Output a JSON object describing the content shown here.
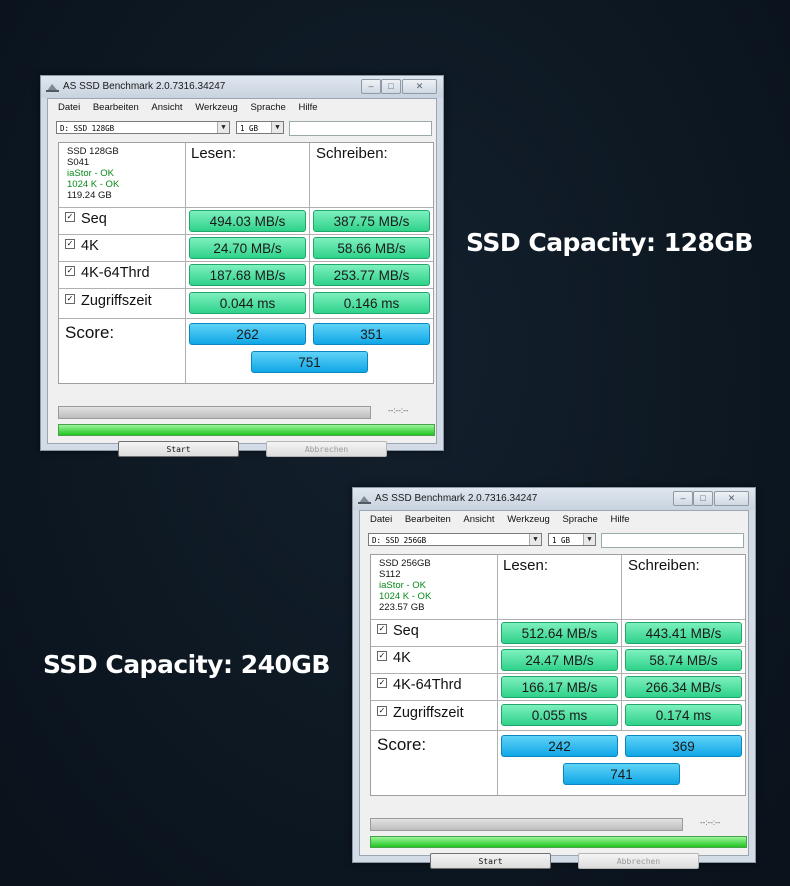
{
  "captions": [
    {
      "prefix": "SSD Capacity:",
      "value": "128GB"
    },
    {
      "prefix": "SSD Capacity:",
      "value": "240GB"
    }
  ],
  "windows": [
    {
      "title": "AS SSD Benchmark 2.0.7316.34247",
      "menu": [
        "Datei",
        "Bearbeiten",
        "Ansicht",
        "Werkzeug",
        "Sprache",
        "Hilfe"
      ],
      "drive": "D: SSD 128GB",
      "size": "1 GB",
      "info": {
        "model": "SSD 128GB",
        "firmware": "S041",
        "driver": "iaStor - OK",
        "alignment": "1024 K - OK",
        "capacity": "119.24 GB"
      },
      "col_read": "Lesen:",
      "col_write": "Schreiben:",
      "rows": [
        {
          "label": "Seq",
          "read": "494.03 MB/s",
          "write": "387.75 MB/s"
        },
        {
          "label": "4K",
          "read": "24.70 MB/s",
          "write": "58.66 MB/s"
        },
        {
          "label": "4K-64Thrd",
          "read": "187.68 MB/s",
          "write": "253.77 MB/s"
        },
        {
          "label": "Zugriffszeit",
          "read": "0.044 ms",
          "write": "0.146 ms"
        }
      ],
      "score_label": "Score:",
      "score_read": "262",
      "score_write": "351",
      "score_total": "751",
      "time": "--:--:--",
      "start": "Start",
      "abort": "Abbrechen"
    },
    {
      "title": "AS SSD Benchmark 2.0.7316.34247",
      "menu": [
        "Datei",
        "Bearbeiten",
        "Ansicht",
        "Werkzeug",
        "Sprache",
        "Hilfe"
      ],
      "drive": "D: SSD 256GB",
      "size": "1 GB",
      "info": {
        "model": "SSD 256GB",
        "firmware": "S112",
        "driver": "iaStor - OK",
        "alignment": "1024 K - OK",
        "capacity": "223.57 GB"
      },
      "col_read": "Lesen:",
      "col_write": "Schreiben:",
      "rows": [
        {
          "label": "Seq",
          "read": "512.64 MB/s",
          "write": "443.41 MB/s"
        },
        {
          "label": "4K",
          "read": "24.47 MB/s",
          "write": "58.74 MB/s"
        },
        {
          "label": "4K-64Thrd",
          "read": "166.17 MB/s",
          "write": "266.34 MB/s"
        },
        {
          "label": "Zugriffszeit",
          "read": "0.055 ms",
          "write": "0.174 ms"
        }
      ],
      "score_label": "Score:",
      "score_read": "242",
      "score_write": "369",
      "score_total": "741",
      "time": "--:--:--",
      "start": "Start",
      "abort": "Abbrechen"
    }
  ],
  "icons": {
    "checkbox_checked": "✓",
    "dropdown_arrow": "▼"
  }
}
